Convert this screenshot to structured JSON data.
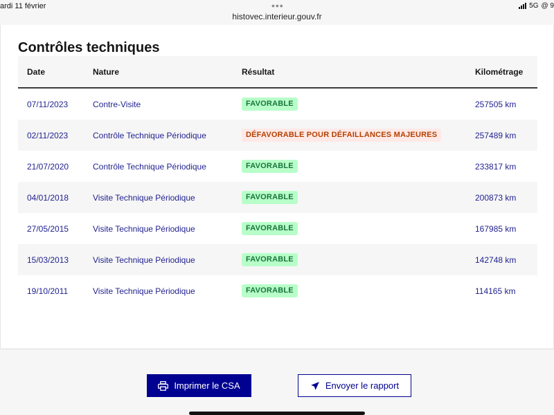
{
  "statusbar": {
    "date": "ardi 11 février",
    "dots": "•••",
    "url": "histovec.interieur.gouv.fr",
    "network": "5G",
    "extra": "@ 9"
  },
  "section": {
    "title": "Contrôles techniques"
  },
  "table": {
    "headers": {
      "date": "Date",
      "nature": "Nature",
      "result": "Résultat",
      "km": "Kilométrage"
    },
    "rows": [
      {
        "date": "07/11/2023",
        "nature": "Contre-Visite",
        "result": "FAVORABLE",
        "status": "ok",
        "km": "257505 km"
      },
      {
        "date": "02/11/2023",
        "nature": "Contrôle Technique Périodique",
        "result": "DÉFAVORABLE POUR DÉFAILLANCES MAJEURES",
        "status": "ko",
        "km": "257489 km"
      },
      {
        "date": "21/07/2020",
        "nature": "Contrôle Technique Périodique",
        "result": "FAVORABLE",
        "status": "ok",
        "km": "233817 km"
      },
      {
        "date": "04/01/2018",
        "nature": "Visite Technique Périodique",
        "result": "FAVORABLE",
        "status": "ok",
        "km": "200873 km"
      },
      {
        "date": "27/05/2015",
        "nature": "Visite Technique Périodique",
        "result": "FAVORABLE",
        "status": "ok",
        "km": "167985 km"
      },
      {
        "date": "15/03/2013",
        "nature": "Visite Technique Périodique",
        "result": "FAVORABLE",
        "status": "ok",
        "km": "142748 km"
      },
      {
        "date": "19/10/2011",
        "nature": "Visite Technique Périodique",
        "result": "FAVORABLE",
        "status": "ok",
        "km": "114165 km"
      }
    ]
  },
  "footer": {
    "print_label": "Imprimer le CSA",
    "send_label": "Envoyer le rapport",
    "print_icon": "printer-icon",
    "send_icon": "paper-plane-icon"
  },
  "colors": {
    "primary": "#000091",
    "ok_bg": "#b8fec9",
    "ok_text": "#18753c",
    "ko_bg": "#ffe9e6",
    "ko_text": "#b34000"
  }
}
